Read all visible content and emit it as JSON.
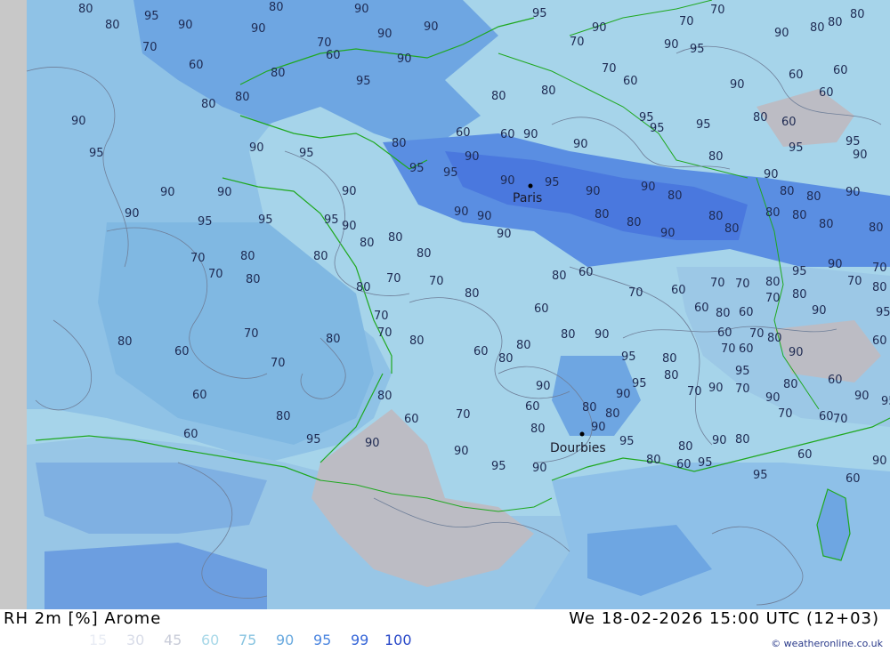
{
  "header": {
    "left_title": "RH 2m [%] Arome",
    "right_title": "We 18-02-2026 15:00 UTC (12+03)"
  },
  "legend": {
    "items": [
      {
        "label": "15",
        "color": "#e8ecf4"
      },
      {
        "label": "30",
        "color": "#d8dce8"
      },
      {
        "label": "45",
        "color": "#c8ccd8"
      },
      {
        "label": "60",
        "color": "#a8d8e8"
      },
      {
        "label": "75",
        "color": "#88c4e0"
      },
      {
        "label": "90",
        "color": "#6aaadf"
      },
      {
        "label": "95",
        "color": "#4c86e0"
      },
      {
        "label": "99",
        "color": "#3666d8"
      },
      {
        "label": "100",
        "color": "#2848c8"
      }
    ]
  },
  "credit": "© weatheronline.co.uk",
  "cities": [
    {
      "name": "Paris"
    },
    {
      "name": "Dourbies"
    }
  ],
  "contour_labels": [
    "80",
    "95",
    "90",
    "80",
    "80",
    "90",
    "95",
    "70",
    "70",
    "80",
    "80",
    "90",
    "90",
    "90",
    "70",
    "60",
    "70",
    "90",
    "90",
    "95",
    "90",
    "80",
    "70",
    "60",
    "80",
    "95",
    "90",
    "70",
    "60",
    "80",
    "80",
    "90",
    "60",
    "60",
    "60",
    "80",
    "80",
    "90",
    "95",
    "90",
    "95",
    "80",
    "60",
    "60",
    "90",
    "90",
    "95",
    "95",
    "95",
    "80",
    "60",
    "95",
    "90",
    "95",
    "95",
    "95",
    "90",
    "90",
    "95",
    "90",
    "90",
    "80",
    "80",
    "90",
    "80",
    "80",
    "90",
    "90",
    "90",
    "90",
    "95",
    "95",
    "95",
    "90",
    "90",
    "80",
    "80",
    "80",
    "90",
    "90",
    "90",
    "80",
    "80",
    "90",
    "80",
    "80",
    "80",
    "80",
    "80",
    "80",
    "70",
    "70",
    "80",
    "80",
    "80",
    "80",
    "70",
    "70",
    "80",
    "80",
    "60",
    "70",
    "60",
    "70",
    "70",
    "80",
    "95",
    "90",
    "70",
    "70",
    "80",
    "60",
    "70",
    "80",
    "60",
    "70",
    "80",
    "70",
    "70",
    "80",
    "60",
    "80",
    "80",
    "80",
    "90",
    "95",
    "80",
    "60",
    "80",
    "60",
    "70",
    "80",
    "90",
    "95",
    "60",
    "70",
    "80",
    "70",
    "60",
    "90",
    "60",
    "60",
    "80",
    "80",
    "60",
    "70",
    "90",
    "60",
    "80",
    "80",
    "90",
    "95",
    "80",
    "70",
    "90",
    "95",
    "70",
    "90",
    "80",
    "60",
    "90",
    "95",
    "70",
    "60",
    "60",
    "95",
    "90",
    "90",
    "95",
    "90",
    "80",
    "90",
    "95",
    "80",
    "80",
    "60",
    "95",
    "90",
    "80",
    "95",
    "60",
    "90",
    "70",
    "60"
  ]
}
